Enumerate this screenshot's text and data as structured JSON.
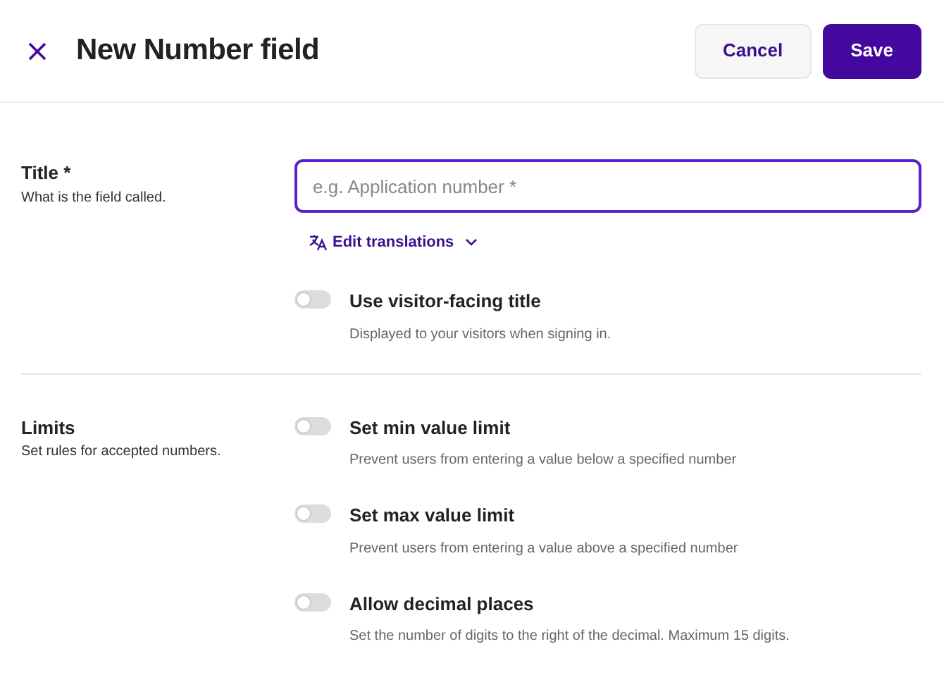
{
  "header": {
    "title": "New Number field",
    "buttons": [
      {
        "label": "Cancel",
        "kind": "secondary"
      },
      {
        "label": "Save",
        "kind": "primary"
      }
    ]
  },
  "sections": [
    {
      "title": "Title *",
      "description": "What is the field called.",
      "field": {
        "placeholder": "e.g. Application number *"
      },
      "link": {
        "label": "Edit translations"
      },
      "options": [
        {
          "label": "Use visitor-facing title",
          "description": "Displayed to your visitors when signing in.",
          "on": false
        }
      ]
    },
    {
      "title": "Limits",
      "description": "Set rules for accepted numbers.",
      "options": [
        {
          "label": "Set min value limit",
          "description": "Prevent users from entering a value below a specified number",
          "on": false
        },
        {
          "label": "Set max value limit",
          "description": "Prevent users from entering a value above a specified number",
          "on": false
        },
        {
          "label": "Allow decimal places",
          "description": "Set the number of digits to the right of the decimal. Maximum 15 digits.",
          "on": false
        }
      ]
    }
  ]
}
